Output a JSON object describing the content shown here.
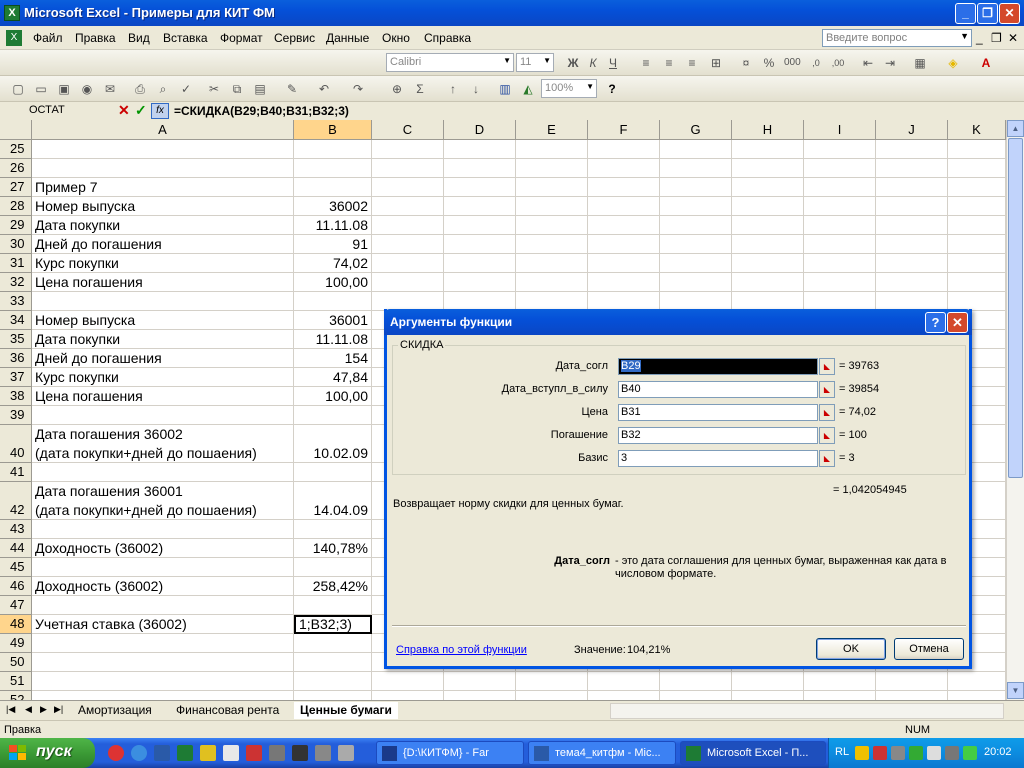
{
  "window": {
    "title": "Microsoft Excel - Примеры для КИТ ФМ"
  },
  "menu": {
    "items": [
      "Файл",
      "Правка",
      "Вид",
      "Вставка",
      "Формат",
      "Сервис",
      "Данные",
      "Окно",
      "Справка"
    ],
    "help_placeholder": "Введите вопрос"
  },
  "toolbar": {
    "font": "Calibri",
    "size": "11",
    "zoom": "100%"
  },
  "formula_bar": {
    "name_box": "ОСТАТ",
    "formula": "=СКИДКА(B29;B40;B31;B32;3)"
  },
  "grid": {
    "columns": [
      "A",
      "B",
      "C",
      "D",
      "E",
      "F",
      "G",
      "H",
      "I",
      "J",
      "K"
    ],
    "rows": [
      {
        "n": "25",
        "a": "",
        "b": ""
      },
      {
        "n": "26",
        "a": "",
        "b": ""
      },
      {
        "n": "27",
        "a": "Пример 7",
        "b": ""
      },
      {
        "n": "28",
        "a": "Номер выпуска",
        "b": "36002"
      },
      {
        "n": "29",
        "a": "Дата покупки",
        "b": "11.11.08"
      },
      {
        "n": "30",
        "a": "Дней до погашения",
        "b": "91"
      },
      {
        "n": "31",
        "a": "Курс покупки",
        "b": "74,02"
      },
      {
        "n": "32",
        "a": "Цена погашения",
        "b": "100,00"
      },
      {
        "n": "33",
        "a": "",
        "b": ""
      },
      {
        "n": "34",
        "a": "Номер выпуска",
        "b": "36001"
      },
      {
        "n": "35",
        "a": "Дата покупки",
        "b": "11.11.08"
      },
      {
        "n": "36",
        "a": "Дней до погашения",
        "b": "154"
      },
      {
        "n": "37",
        "a": "Курс покупки",
        "b": "47,84"
      },
      {
        "n": "38",
        "a": "Цена погашения",
        "b": "100,00"
      },
      {
        "n": "39",
        "a": "",
        "b": ""
      },
      {
        "n": "40",
        "a": "Дата погашения 36002",
        "a2": "(дата покупки+дней до пошаения)",
        "b": "10.02.09"
      },
      {
        "n": "41",
        "a": "",
        "b": ""
      },
      {
        "n": "42",
        "a": "Дата погашения 36001",
        "a2": "(дата покупки+дней до пошаения)",
        "b": "14.04.09"
      },
      {
        "n": "43",
        "a": "",
        "b": ""
      },
      {
        "n": "44",
        "a": "Доходность (36002)",
        "b": "140,78%"
      },
      {
        "n": "45",
        "a": "",
        "b": ""
      },
      {
        "n": "46",
        "a": "Доходность (36002)",
        "b": "258,42%"
      },
      {
        "n": "47",
        "a": "",
        "b": ""
      },
      {
        "n": "48",
        "a": "Учетная ставка (36002)",
        "b": "1;B32;3)"
      },
      {
        "n": "49",
        "a": "",
        "b": ""
      },
      {
        "n": "50",
        "a": "",
        "b": ""
      },
      {
        "n": "51",
        "a": "",
        "b": ""
      },
      {
        "n": "52",
        "a": "",
        "b": ""
      }
    ]
  },
  "sheets": {
    "tabs": [
      "Амортизация",
      "Финансовая рента",
      "Ценные бумаги"
    ],
    "active": "Ценные бумаги"
  },
  "status": {
    "mode": "Правка",
    "num": "NUM"
  },
  "dialog": {
    "title": "Аргументы функции",
    "function_name": "СКИДКА",
    "args": [
      {
        "label": "Дата_согл",
        "input": "B29",
        "value": "= 39763"
      },
      {
        "label": "Дата_вступл_в_силу",
        "input": "B40",
        "value": "= 39854"
      },
      {
        "label": "Цена",
        "input": "B31",
        "value": "= 74,02"
      },
      {
        "label": "Погашение",
        "input": "B32",
        "value": "= 100"
      },
      {
        "label": "Базис",
        "input": "3",
        "value": "= 3"
      }
    ],
    "result": "= 1,042054945",
    "description": "Возвращает норму скидки для ценных бумаг.",
    "arg_help_name": "Дата_согл",
    "arg_help_text": "- это дата соглашения для ценных бумаг, выраженная как дата в числовом формате.",
    "help_link": "Справка по этой функции",
    "value_label": "Значение:",
    "value": "104,21%",
    "ok": "OK",
    "cancel": "Отмена"
  },
  "taskbar": {
    "start": "пуск",
    "tasks": [
      "{D:\\КИТФМ} - Far",
      "тема4_китфм - Mic...",
      "Microsoft Excel - П..."
    ],
    "lang": "RL",
    "clock": "20:02"
  }
}
